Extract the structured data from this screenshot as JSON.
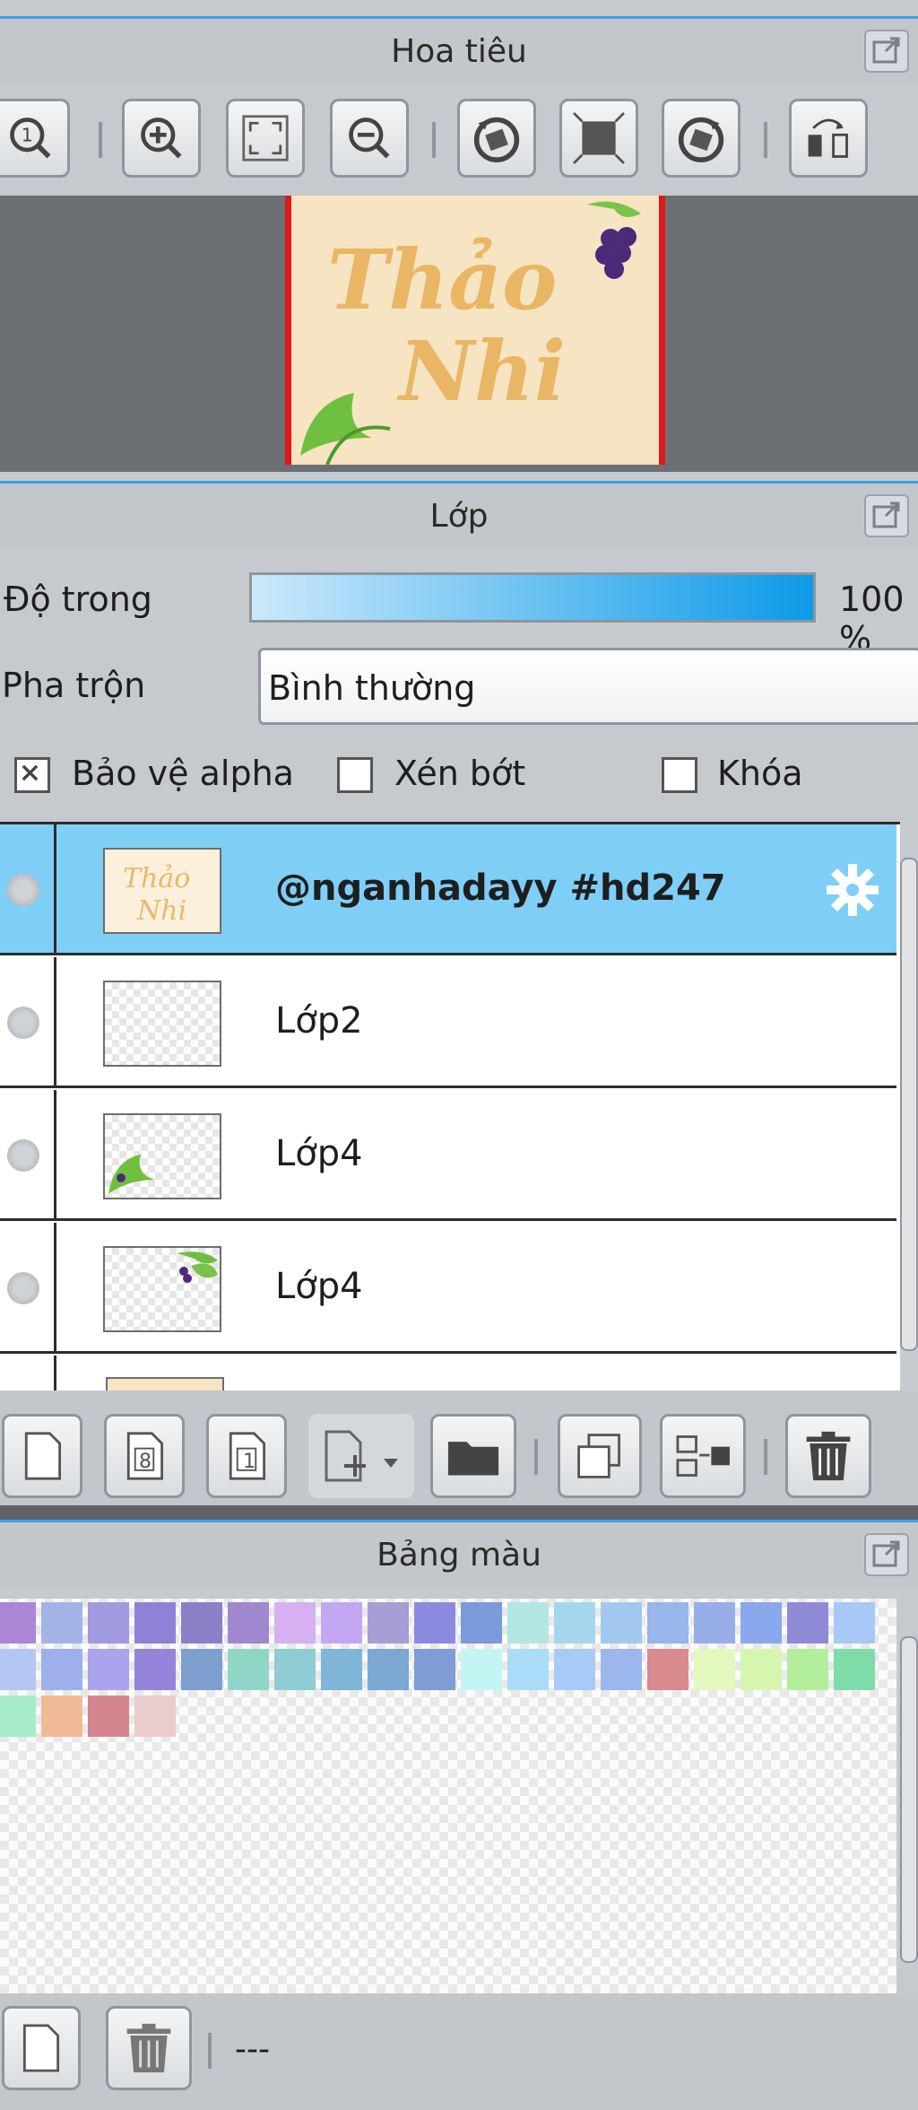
{
  "navigator": {
    "title": "Hoa tiêu",
    "preview_text_1": "Thảo",
    "preview_text_2": "Nhi"
  },
  "layers_panel": {
    "title": "Lớp",
    "opacity_label": "Độ trong",
    "opacity_value": "100 %",
    "blend_label": "Pha trộn",
    "blend_value": "Bình thường",
    "protect_alpha_label": "Bảo vệ alpha",
    "clip_label": "Xén bớt",
    "lock_label": "Khóa",
    "protect_alpha_checked": true,
    "clip_checked": false,
    "lock_checked": false,
    "layers": [
      {
        "name": "@nganhadayy #hd247",
        "selected": true
      },
      {
        "name": "Lớp2",
        "selected": false
      },
      {
        "name": "Lớp4",
        "selected": false
      },
      {
        "name": "Lớp4",
        "selected": false
      }
    ],
    "toolbar": {
      "new_layer_8": "8",
      "new_layer_1": "1"
    }
  },
  "palette_panel": {
    "title": "Bảng màu",
    "status_text": "---",
    "swatches_row1": [
      "#a987d6",
      "#a3b3e6",
      "#a09be0",
      "#8d82d6",
      "#8a80c8",
      "#9f88cf",
      "#d5b1f2",
      "#c3a7f4",
      "#a79ed6",
      "#8a8be0",
      "#7a9adc",
      "#b1e6e3",
      "#a4d7ee",
      "#a3c8f0",
      "#97b6ea",
      "#98aee9",
      "#8aa8ec",
      "#8e8ad6",
      "#a8c8f6"
    ],
    "swatches_row2": [
      "#b6c6f2",
      "#9db0ec",
      "#a9a4ec",
      "#9683da",
      "#7e9ed0",
      "#8fd6c8",
      "#8fccd4",
      "#7fb6d8",
      "#7aa8d2",
      "#7f9cd4",
      "#c2f6f4",
      "#a9dcf6",
      "#a8caf6",
      "#9cb6ee",
      "#d98a8e",
      "#e2f8bc",
      "#d6f6b0",
      "#b2ee9c",
      "#7edca8"
    ],
    "swatches_row3": [
      "#a6eccc",
      "#f0ba96",
      "#d4868e",
      "#eacccc"
    ]
  }
}
